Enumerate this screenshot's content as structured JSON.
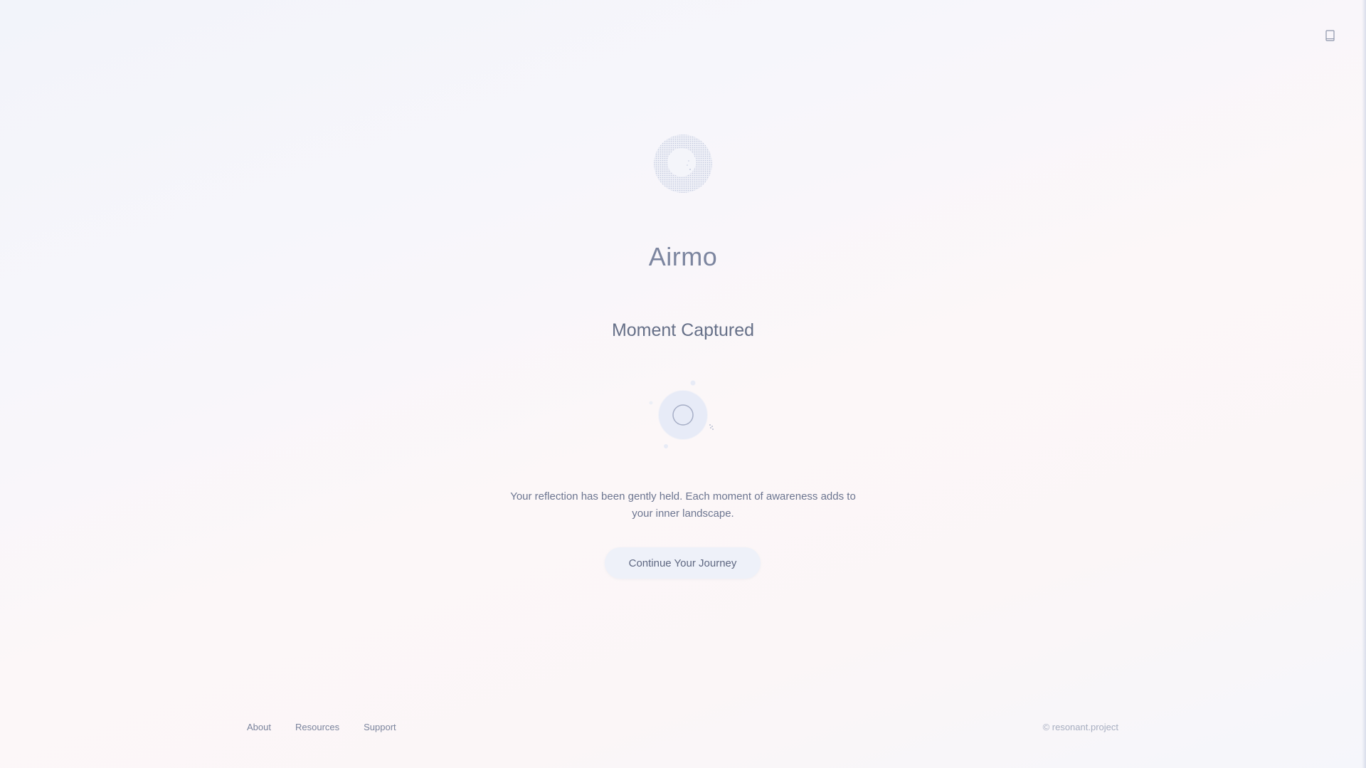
{
  "header": {
    "icon": "book-icon"
  },
  "brand": {
    "logo_icon": "dotted-ring-logo-icon",
    "name": "Airmo"
  },
  "main": {
    "heading": "Moment Captured",
    "status_icon": "spinner-circle-icon",
    "message": "Your reflection has been gently held. Each moment of awareness adds to your inner landscape.",
    "cta_label": "Continue Your Journey"
  },
  "footer": {
    "links": [
      "About",
      "Resources",
      "Support"
    ],
    "copyright": "© resonant.project"
  },
  "colors": {
    "text_primary": "#667088",
    "text_muted": "#a7aec0",
    "button_bg": "#eef1f9",
    "logo_dots": "#c3c9de"
  }
}
